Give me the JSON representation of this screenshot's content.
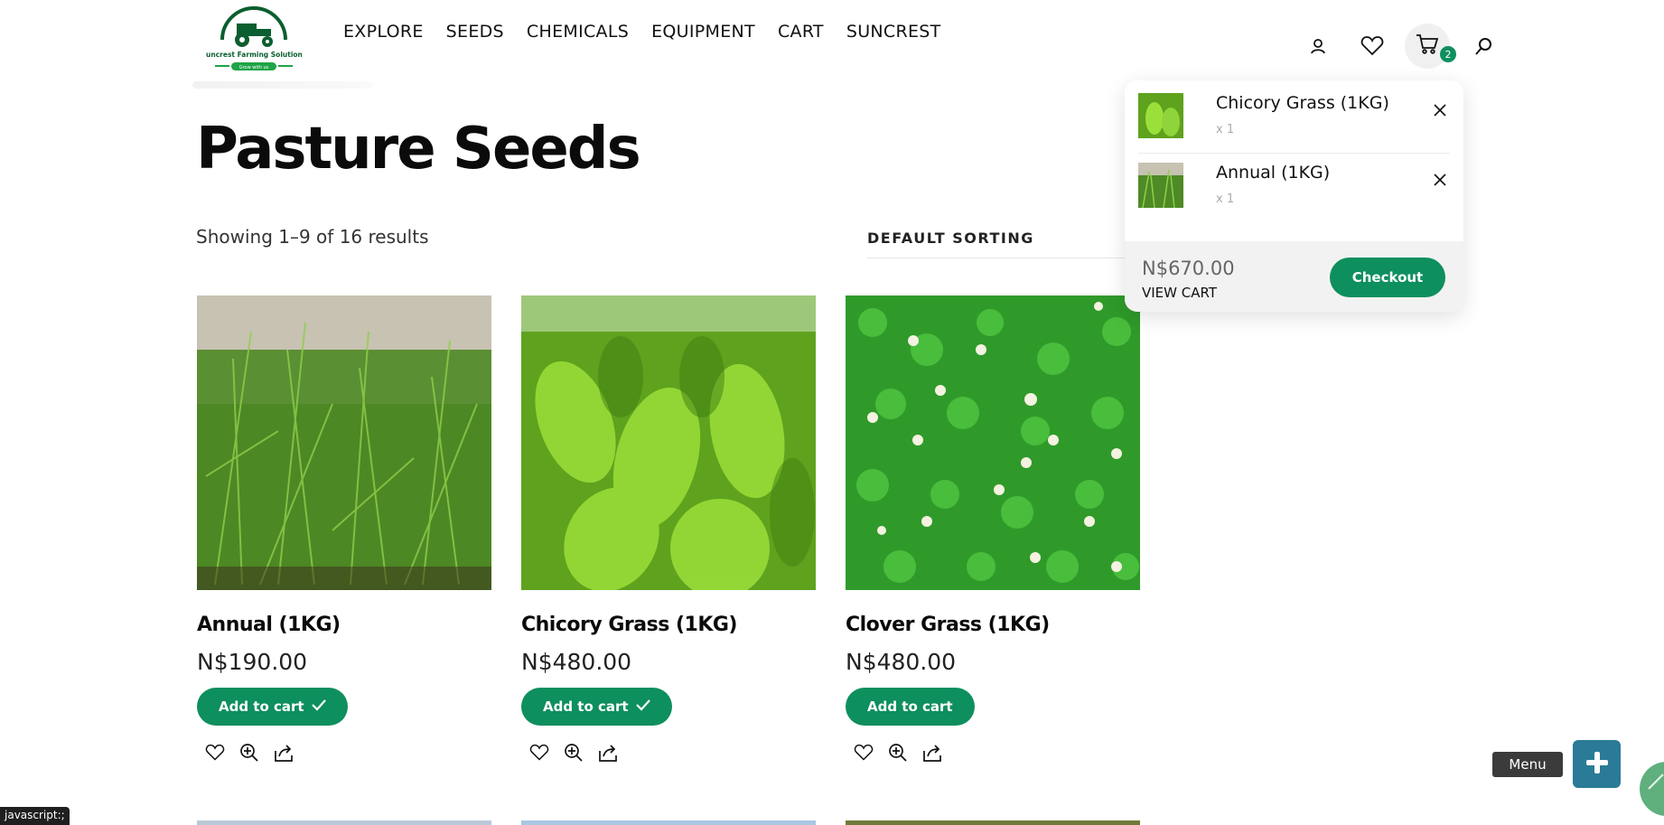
{
  "header": {
    "logo_text": "Suncrest Farming Solutions",
    "logo_tagline": "Grow with us",
    "nav": [
      "EXPLORE",
      "SEEDS",
      "CHEMICALS",
      "EQUIPMENT",
      "CART",
      "SUNCREST"
    ],
    "cart_count": "2"
  },
  "page": {
    "title": "Pasture Seeds",
    "result_count": "Showing 1–9 of 16 results",
    "sorting": "DEFAULT SORTING"
  },
  "products": [
    {
      "name": "Annual (1KG)",
      "price": "N$190.00",
      "button": "Add to cart",
      "in_cart": true
    },
    {
      "name": "Chicory Grass (1KG)",
      "price": "N$480.00",
      "button": "Add to cart",
      "in_cart": true
    },
    {
      "name": "Clover Grass (1KG)",
      "price": "N$480.00",
      "button": "Add to cart",
      "in_cart": false
    }
  ],
  "mini_cart": {
    "items": [
      {
        "name": "Chicory Grass (1KG)",
        "qty": "x 1"
      },
      {
        "name": "Annual (1KG)",
        "qty": "x 1"
      }
    ],
    "total": "N$670.00",
    "view_cart": "VIEW CART",
    "checkout": "Checkout"
  },
  "status_bar": "javascript:;",
  "menu_tooltip": "Menu",
  "colors": {
    "accent": "#0e8f5e",
    "menu_button": "#2a7b97"
  }
}
